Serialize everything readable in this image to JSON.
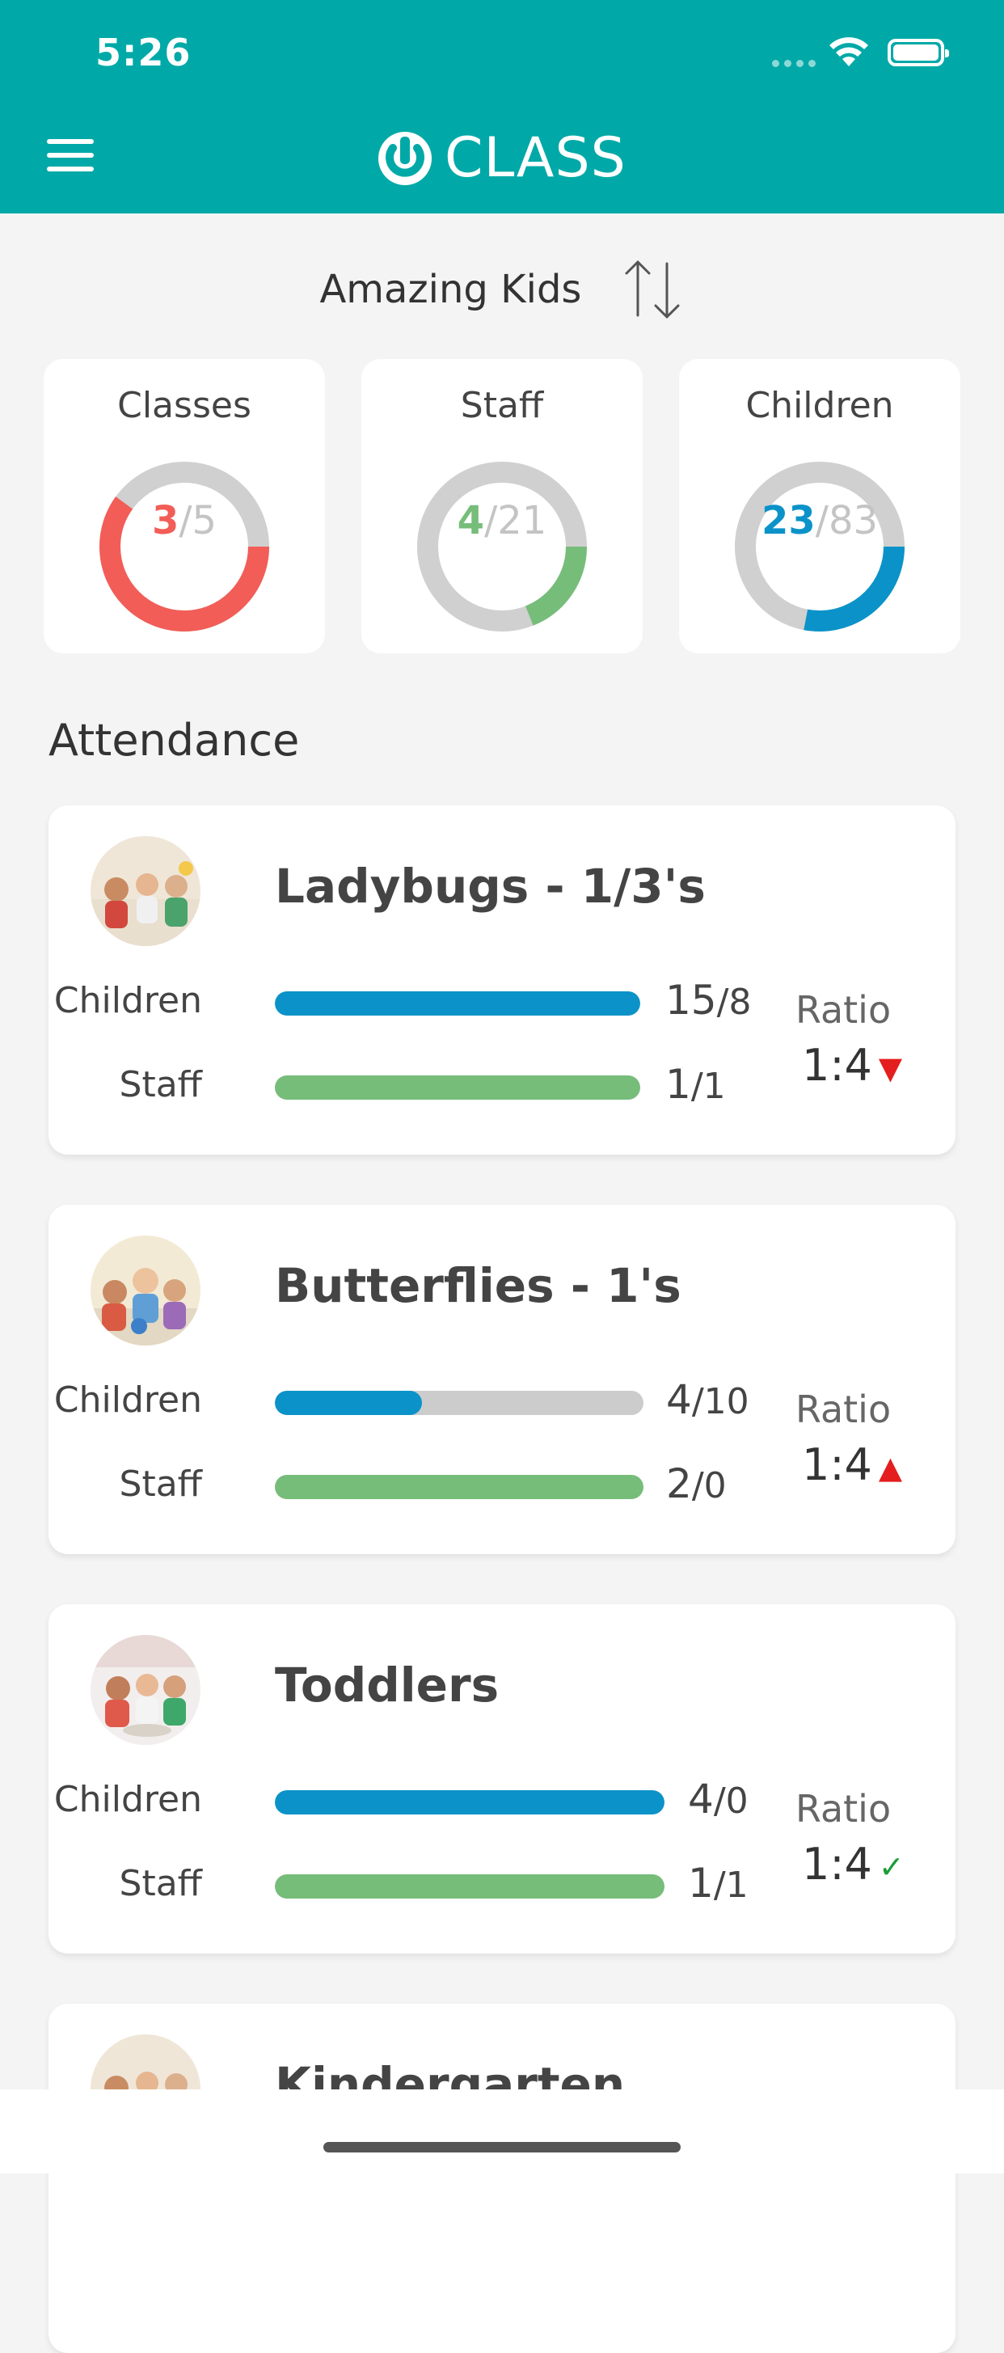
{
  "status_bar": {
    "time": "5:26"
  },
  "header": {
    "brand": "CLASS"
  },
  "center": {
    "name": "Amazing Kids"
  },
  "stats": [
    {
      "title": "Classes",
      "current": "3",
      "total": "/5",
      "fraction": 0.6,
      "color": "#f25d57"
    },
    {
      "title": "Staff",
      "current": "4",
      "total": "/21",
      "fraction": 0.19,
      "color": "#76bd7a"
    },
    {
      "title": "Children",
      "current": "23",
      "total": "/83",
      "fraction": 0.28,
      "color": "#0b93c9"
    }
  ],
  "attendance": {
    "title": "Attendance",
    "classes": [
      {
        "name": "Ladybugs - 1/3's",
        "children_label": "Children",
        "children_present": "15",
        "children_sep": "/8",
        "children_fraction": 1.0,
        "staff_label": "Staff",
        "staff_present": "1",
        "staff_sep": "/1",
        "staff_fraction": 1.0,
        "ratio_label": "Ratio",
        "ratio": "1:4",
        "ratio_mark": "▼",
        "ratio_color": "#e41e1e"
      },
      {
        "name": "Butterflies - 1's",
        "children_label": "Children",
        "children_present": "4",
        "children_sep": "/10",
        "children_fraction": 0.4,
        "staff_label": "Staff",
        "staff_present": "2",
        "staff_sep": "/0",
        "staff_fraction": 1.0,
        "ratio_label": "Ratio",
        "ratio": "1:4",
        "ratio_mark": "▲",
        "ratio_color": "#e41e1e"
      },
      {
        "name": "Toddlers",
        "children_label": "Children",
        "children_present": "4",
        "children_sep": "/0",
        "children_fraction": 1.0,
        "staff_label": "Staff",
        "staff_present": "1",
        "staff_sep": "/1",
        "staff_fraction": 1.0,
        "ratio_label": "Ratio",
        "ratio": "1:4",
        "ratio_mark": "✓",
        "ratio_color": "#1a9c3a"
      },
      {
        "name": "Kindergarten"
      }
    ]
  }
}
